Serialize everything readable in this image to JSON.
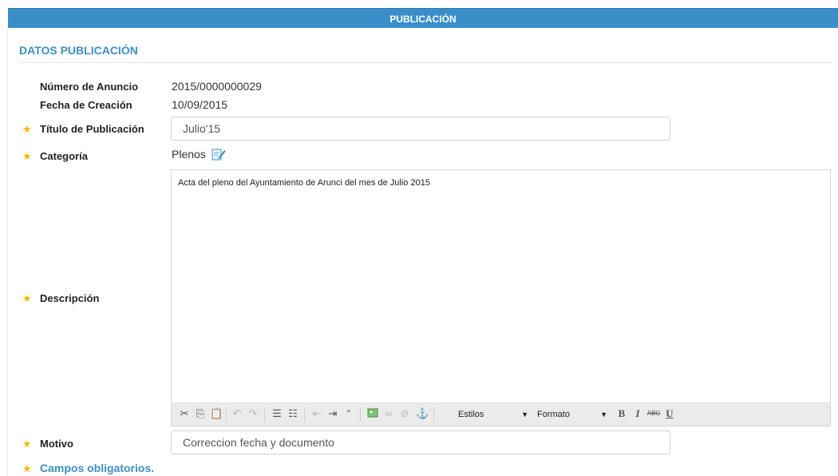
{
  "header": {
    "title": "PUBLICACIÓN"
  },
  "section": {
    "title": "DATOS PUBLICACIÓN"
  },
  "fields": {
    "numero": {
      "label": "Número de Anuncio",
      "value": "2015/0000000029"
    },
    "fecha": {
      "label": "Fecha de Creación",
      "value": "10/09/2015"
    },
    "titulo": {
      "label": "Título de Publicación",
      "value": "Julio'15"
    },
    "categoria": {
      "label": "Categoría",
      "value": "Plenos"
    },
    "descripcion": {
      "label": "Descripción",
      "value": "Acta del pleno del Ayuntamiento de Arunci del mes de Julio 2015"
    },
    "motivo": {
      "label": "Motivo",
      "value": "Correccion fecha y documento"
    }
  },
  "toolbar": {
    "estilos": "Estilos",
    "formato": "Formato",
    "bold": "B",
    "italic": "I",
    "strike": "ABC",
    "underline": "U"
  },
  "footer": {
    "note": "Campos obligatorios."
  },
  "colors": {
    "accent": "#3b8fc9",
    "required_star": "#f5b800"
  },
  "icons": [
    "cut-icon",
    "copy-icon",
    "paste-icon",
    "undo-icon",
    "redo-icon",
    "numbered-list-icon",
    "bullet-list-icon",
    "outdent-icon",
    "indent-icon",
    "blockquote-icon",
    "image-icon",
    "link-icon",
    "unlink-icon",
    "anchor-icon",
    "edit-icon",
    "star-icon"
  ]
}
